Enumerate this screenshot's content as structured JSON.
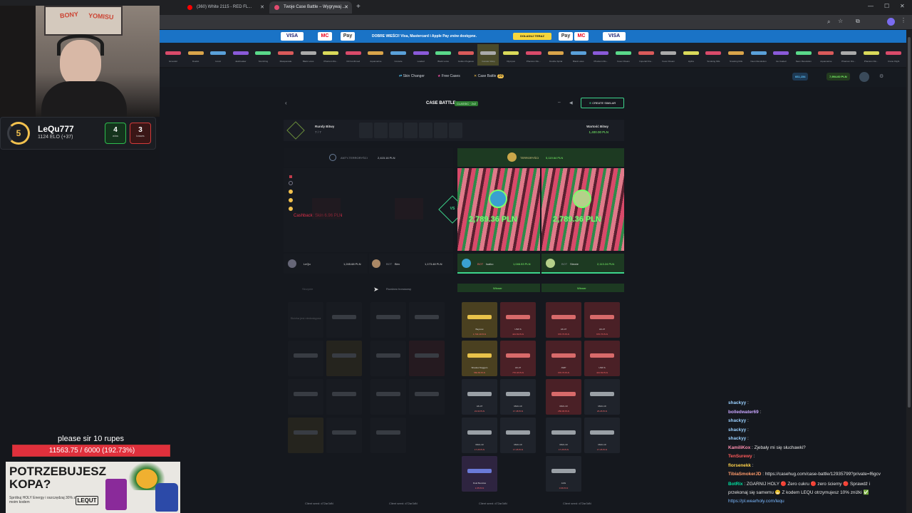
{
  "browser": {
    "tabs": [
      {
        "label": "(360) White 2115 - RED FL...",
        "active": false
      },
      {
        "label": "Twoje Case Battle – Wygrywaj ...",
        "active": true
      }
    ],
    "new_tab": "+"
  },
  "banner": {
    "promo_text": "DOBRE WIEŚCI! Visa, Mastercard i Apple Pay znów dostępne.",
    "cta": "DOŁADUJ TERAZ",
    "cards": [
      "VISA",
      "MC",
      "Pay",
      "Pay",
      "MC",
      "VISA"
    ]
  },
  "skin_strip": [
    "Emerald",
    "Duelist",
    "Iconic",
    "Jawbreaker",
    "Scorching",
    "Masquerade",
    "Black Lotus",
    "Phantom Dis...",
    "Kill Confirmed",
    "Aquamarine",
    "Console",
    "Loaded",
    "Black Lotus",
    "Golden Pegasus",
    "Cassias Warp",
    "Olympus",
    "Phantom Dis...",
    "Double Spiral",
    "Black Lotus",
    "Phantom Dis...",
    "Fever Dream",
    "Imperial Dra...",
    "Fever Dream",
    "Hydra",
    "Smoking Kills",
    "Smoking Kills",
    "Neon Revolution",
    "Ice Coaled",
    "Neon Revolution",
    "Aquamarine",
    "Phantom Dis...",
    "Phantom Dis...",
    "Crane Flight"
  ],
  "site_nav": {
    "items": [
      "Skin Changer",
      "Free Cases",
      "Case Battle"
    ],
    "case_battle_badge": "20",
    "balance1": "661,154",
    "balance2": "7,994.60 PLN"
  },
  "battle": {
    "title": "CASE BATTLE",
    "mode_badge": "CLASSIC · 2v2",
    "create_similar": "CREATE SIMILAR",
    "rounds_label": "Rundy Bitwy",
    "rounds_value": "7 / 7",
    "value_label": "Wartość Bitwy",
    "value": "1,400.00 PLN",
    "team_ct_label": "ANTY-TERRORYŚCI",
    "team_ct_total": "2,415.16 PLN",
    "team_t_label": "TERRORYŚCI",
    "team_t_total": "5,119.64 PLN",
    "cashback": "Cashback: Skin 6.96 PLN",
    "vs": "VS",
    "winner_price_1": "2,789.36 PLN",
    "winner_price_2": "2,789.36 PLN",
    "players": [
      {
        "name": "LeQu",
        "total": "1,245.68 PLN"
      },
      {
        "name": "Bim",
        "total": "1,173.48 PLN"
      },
      {
        "name": "Isaiko",
        "total": "1,046.53 PLN"
      },
      {
        "name": "Stewie",
        "total": "2,113.24 PLN"
      }
    ],
    "bot_tag": "BOT",
    "winner_label": "Winner",
    "col2_label": "Rozdano bonusowy",
    "col1_label": "Skrzynie",
    "empty_text": "Skórka jest niedostępna",
    "client_seed_label": "Client seed:",
    "client_seed": "d72ar3dN",
    "items_t": [
      {
        "name": "Bayonet",
        "price": "1,740.49 PLN",
        "color": "gold"
      },
      {
        "name": "USP-S",
        "price": "421.69 PLN",
        "color": "red"
      },
      {
        "name": "AK-47",
        "price": "670.76 PLN",
        "color": "red"
      },
      {
        "name": "AK-47",
        "price": "670.76 PLN",
        "color": "red"
      },
      {
        "name": "Shadow Daggers",
        "price": "560.83 PLN",
        "color": "gold"
      },
      {
        "name": "AK-47",
        "price": "770.46 PLN",
        "color": "red"
      },
      {
        "name": "AWP",
        "price": "670.76 PLN",
        "color": "red"
      },
      {
        "name": "USP-S",
        "price": "421.69 PLN",
        "color": "red"
      },
      {
        "name": "AK-47",
        "price": "22.02 PLN",
        "color": "none"
      },
      {
        "name": "MAC-10",
        "price": "17.48 PLN",
        "color": "none"
      },
      {
        "name": "MAC-10",
        "price": "250.06 PLN",
        "color": "red"
      },
      {
        "name": "MAC-10",
        "price": "26.26 PLN",
        "color": "none"
      },
      {
        "name": "MAC-10",
        "price": "17.26 PLN",
        "color": "none"
      },
      {
        "name": "MAC-10",
        "price": "17.26 PLN",
        "color": "none"
      },
      {
        "name": "MAC-10",
        "price": "17.26 PLN",
        "color": "none"
      },
      {
        "name": "MAC-10",
        "price": "17.26 PLN",
        "color": "none"
      },
      {
        "name": "Dual Berettas",
        "price": "1.65 PLN",
        "color": "purple"
      },
      {
        "name": "AUG",
        "price": "0.96 PLN",
        "color": "none"
      }
    ]
  },
  "overlay": {
    "player_name": "LeQu777",
    "elo": "1124 ELO (+37)",
    "level": "5",
    "wins": "4",
    "wins_label": "wins",
    "losses": "3",
    "losses_label": "losses",
    "goal_text": "please sir 10 rupes",
    "goal_progress": "11563.75 / 6000 (192.73%)",
    "goal_fraction": 1.0,
    "ad_headline_1": "POTRZEBUJESZ",
    "ad_headline_2": "KOPA?",
    "ad_sub": "Spróbuj HOLY Energy i oszczędzaj 30% z moim kodem",
    "ad_code": "LEQUT",
    "webcam_label_1": "BONY",
    "webcam_label_2": "YOMISU"
  },
  "chat": [
    {
      "user": "shackyy",
      "text": "",
      "color": "#9ad0ff"
    },
    {
      "user": "bolledwater69",
      "text": "",
      "color": "#c9a6ff"
    },
    {
      "user": "shackyy",
      "text": "",
      "color": "#9ad0ff"
    },
    {
      "user": "shackyy",
      "text": "",
      "color": "#9ad0ff"
    },
    {
      "user": "shackyy",
      "text": "",
      "color": "#9ad0ff"
    },
    {
      "user": "KamiliKox",
      "text": "Zjebały mi się słuchawki?",
      "color": "#ff8fb0"
    },
    {
      "user": "TenSurewy",
      "text": "",
      "color": "#ff5a5a"
    },
    {
      "user": "florsenekk",
      "text": "",
      "color": "#ffd24a"
    },
    {
      "user": "TibiaSmokerJD",
      "text": "https://casehug.com/case-battle/12935799?private=f6gcv",
      "color": "#ff9b6b"
    },
    {
      "user": "BotRix",
      "text": "ZGARNIJ HOLY 🔴 Zero cukru 🔴 zero ściemy 🔴 Sprawdź i",
      "color": "#00e0a0"
    },
    {
      "user": "",
      "text": "przekonaj się samemu 😁 Z kodem LEQU otrzymujesz 10% zniżki ✅",
      "color": "#ffffff"
    },
    {
      "user": "",
      "text": "https://pl.wearholy.com/lequ",
      "color": "#ffffff"
    }
  ],
  "colors": {
    "accent_green": "#7dff6b",
    "ct_blue": "#2f6bd8",
    "t_gold": "#f2c14e",
    "brand_blue": "#1a73c6"
  }
}
